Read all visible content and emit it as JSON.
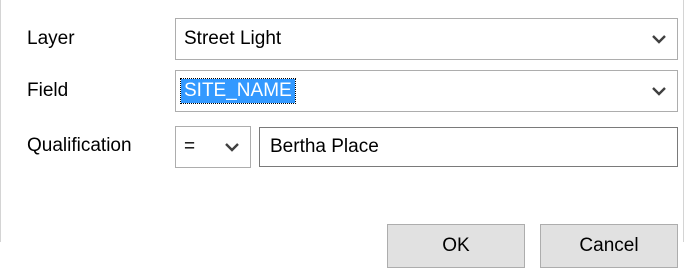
{
  "form": {
    "layer": {
      "label": "Layer",
      "value": "Street Light"
    },
    "field": {
      "label": "Field",
      "value": "SITE_NAME"
    },
    "qualification": {
      "label": "Qualification",
      "operator": "=",
      "value": "Bertha Place"
    }
  },
  "buttons": {
    "ok_label": "OK",
    "cancel_label": "Cancel"
  },
  "icons": {
    "dropdown": "chevron-down-icon"
  },
  "colors": {
    "selection": "#3399ff",
    "button_face": "#e1e1e1",
    "border": "#adadad"
  }
}
